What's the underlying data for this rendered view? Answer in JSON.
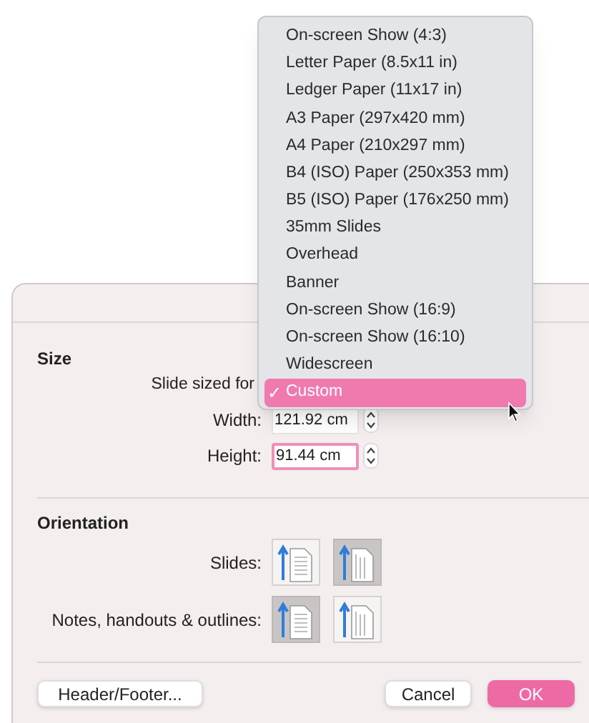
{
  "size": {
    "heading": "Size",
    "slide_sized_for_label": "Slide sized for",
    "checkmark": "✓",
    "menu": [
      {
        "label": "On-screen Show (4:3)",
        "selected": false
      },
      {
        "label": "Letter Paper (8.5x11 in)",
        "selected": false
      },
      {
        "label": "Ledger Paper (11x17 in)",
        "selected": false
      },
      {
        "label": "A3 Paper (297x420 mm)",
        "selected": false
      },
      {
        "label": "A4 Paper (210x297 mm)",
        "selected": false
      },
      {
        "label": "B4 (ISO) Paper (250x353 mm)",
        "selected": false
      },
      {
        "label": "B5 (ISO) Paper (176x250 mm)",
        "selected": false
      },
      {
        "label": "35mm Slides",
        "selected": false
      },
      {
        "label": "Overhead",
        "selected": false
      },
      {
        "label": "Banner",
        "selected": false
      },
      {
        "label": "On-screen Show (16:9)",
        "selected": false
      },
      {
        "label": "On-screen Show (16:10)",
        "selected": false
      },
      {
        "label": "Widescreen",
        "selected": false
      },
      {
        "label": "Custom",
        "selected": true
      }
    ],
    "fields": [
      {
        "label": "Width:",
        "value": "121.92 cm",
        "focused": false
      },
      {
        "label": "Height:",
        "value": "91.44 cm",
        "focused": true
      }
    ]
  },
  "orientation": {
    "heading": "Orientation",
    "rows": [
      {
        "label": "Slides:",
        "options": [
          {
            "kind": "portrait",
            "selected": false
          },
          {
            "kind": "landscape",
            "selected": true
          }
        ]
      },
      {
        "label": "Notes, handouts & outlines:",
        "options": [
          {
            "kind": "portrait",
            "selected": true
          },
          {
            "kind": "landscape",
            "selected": false
          }
        ]
      }
    ]
  },
  "buttons": [
    {
      "label": "Header/Footer...",
      "kind": "secondary"
    },
    {
      "label": "Cancel",
      "kind": "secondary"
    },
    {
      "label": "OK",
      "kind": "default"
    }
  ]
}
